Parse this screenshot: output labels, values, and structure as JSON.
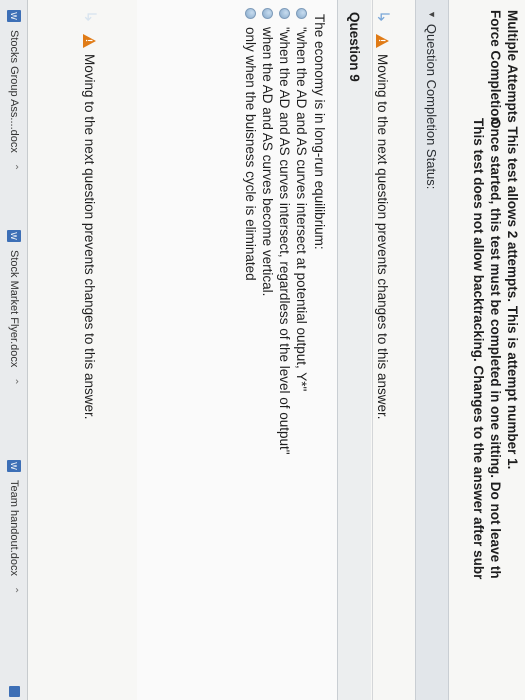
{
  "info": {
    "multiple_label": "Multiple Attempts",
    "multiple_text": "This test allows 2 attempts. This is attempt number 1.",
    "force_label": "Force Completion",
    "force_text": "Once started, this test must be completed in one sitting. Do not leave th",
    "backtrack_text": "This test does not allow backtracking. Changes to the answer after subr"
  },
  "status": {
    "label": "Question Completion Status:"
  },
  "warning": {
    "text": "Moving to the next question prevents changes to this answer."
  },
  "question": {
    "title": "Question 9",
    "text": "The economy is in long-run equilibrium:",
    "answers": [
      "\"when the AD and AS curves intersect at potential output, Y*\"",
      "\"when the AD and AS curves intersect, regardless of the level of output\"",
      "when the AD and AS curves become vertical.",
      "only when the buisness cycle is eliminated"
    ]
  },
  "warning2": {
    "text": "Moving to the next question prevents changes to this answer."
  },
  "downloads": [
    {
      "name": "Stocks Group Ass....docx"
    },
    {
      "name": "Stock Market Flyer.docx"
    },
    {
      "name": "Team handout.docx"
    }
  ]
}
